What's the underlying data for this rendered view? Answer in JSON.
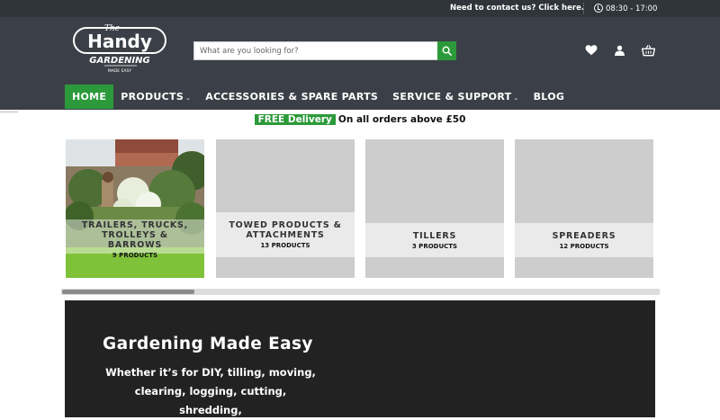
{
  "topbar": {
    "contact_text": "Need to contact us? Click here.",
    "hours": "08:30 - 17:00",
    "hours_icon": "clock-icon"
  },
  "brand": {
    "logo_the": "The",
    "logo_handy": "Handy",
    "logo_gardening": "GARDENING",
    "logo_tagline": "MADE EASY"
  },
  "search": {
    "placeholder": "What are you looking for?",
    "value": "",
    "button_icon": "search-icon"
  },
  "header_icons": [
    "heart-icon",
    "user-icon",
    "basket-icon"
  ],
  "nav": {
    "items": [
      {
        "label": "HOME",
        "active": true
      },
      {
        "label": "PRODUCTS",
        "dropdown": true
      },
      {
        "label": "ACCESSORIES & SPARE PARTS"
      },
      {
        "label": "SERVICE & SUPPORT",
        "dropdown": true
      },
      {
        "label": "BLOG"
      }
    ]
  },
  "delivery": {
    "badge": "FREE Delivery",
    "text": "On all orders above £50"
  },
  "categories": [
    {
      "title": "TRAILERS, TRUCKS, TROLLEYS & BARROWS",
      "count": "9 PRODUCTS"
    },
    {
      "title": "TOWED PRODUCTS & ATTACHMENTS",
      "count": "13 PRODUCTS"
    },
    {
      "title": "TILLERS",
      "count": "3 PRODUCTS"
    },
    {
      "title": "SPREADERS",
      "count": "12 PRODUCTS"
    }
  ],
  "hero": {
    "title": "Gardening Made Easy",
    "text": "Whether it’s for DIY, tilling, moving, clearing, logging, cutting, shredding,"
  },
  "colors": {
    "accent_green": "#2c9a3a",
    "header_bg": "#3b4048",
    "topbar_bg": "#30353c",
    "hero_bg": "#222222"
  }
}
